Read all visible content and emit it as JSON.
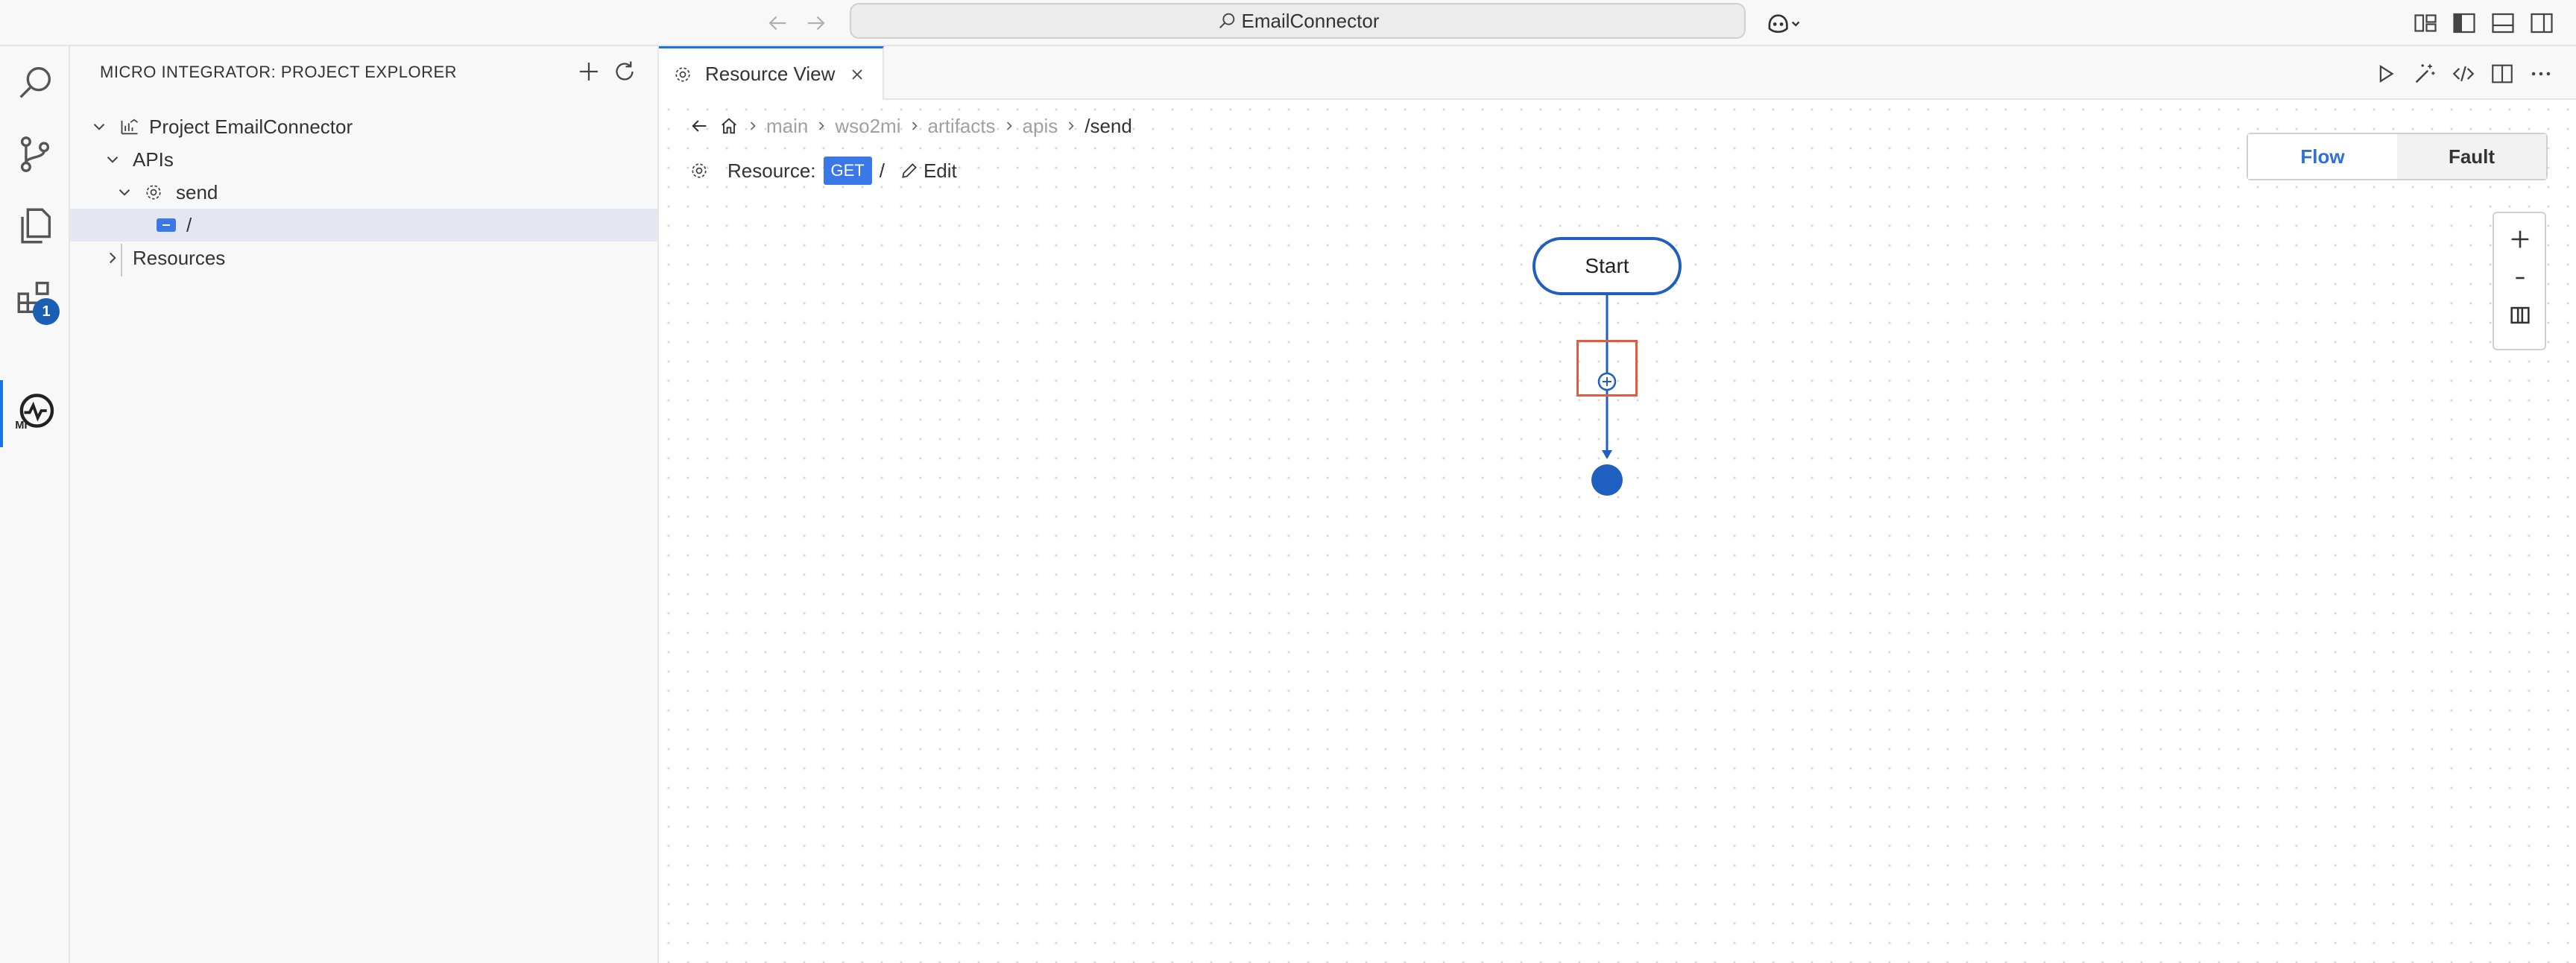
{
  "titlebar": {
    "search_text": "EmailConnector"
  },
  "activity": {
    "extensions_badge": "1"
  },
  "sidebar": {
    "title": "MICRO INTEGRATOR: PROJECT EXPLORER",
    "tree": {
      "project": "Project EmailConnector",
      "apis": "APIs",
      "api_send": "send",
      "resource_root": "/",
      "resources": "Resources"
    }
  },
  "editor": {
    "tab_label": "Resource View",
    "breadcrumb": {
      "items": [
        "main",
        "wso2mi",
        "artifacts",
        "apis"
      ],
      "current": "/send"
    },
    "resource": {
      "label": "Resource:",
      "method": "GET",
      "path": "/",
      "edit_label": "Edit"
    },
    "view_toggle": {
      "flow": "Flow",
      "fault": "Fault"
    },
    "diagram": {
      "start_label": "Start"
    }
  },
  "colors": {
    "accent": "#1a73e8",
    "node_blue": "#1f5fbf",
    "highlight": "#e35a3f"
  }
}
